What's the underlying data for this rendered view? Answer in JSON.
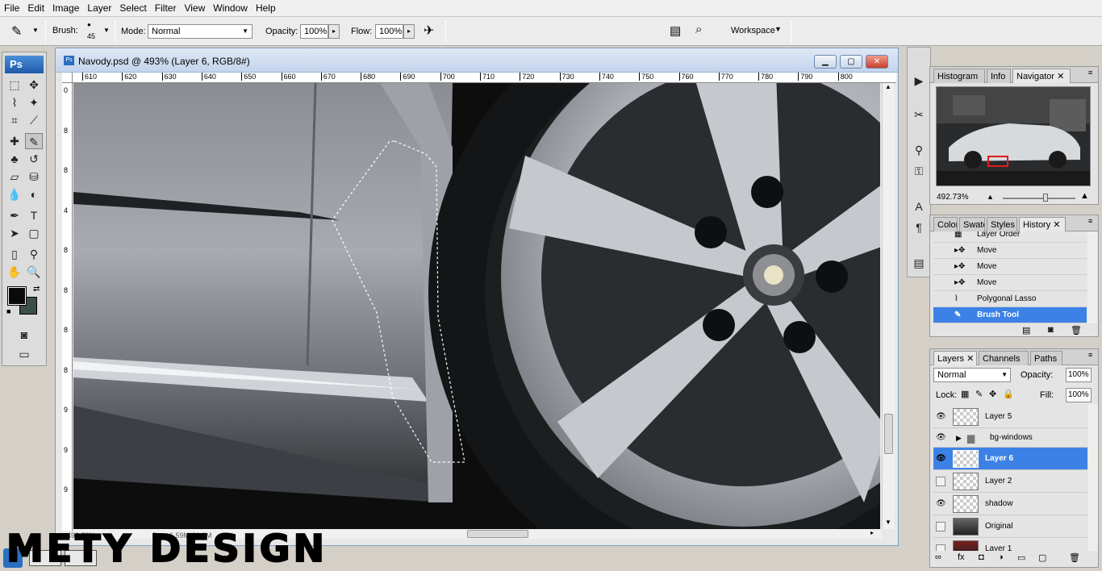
{
  "menu": [
    "File",
    "Edit",
    "Image",
    "Layer",
    "Select",
    "Filter",
    "View",
    "Window",
    "Help"
  ],
  "options": {
    "brush_label": "Brush:",
    "brush_size": "45",
    "mode_label": "Mode:",
    "mode_value": "Normal",
    "opacity_label": "Opacity:",
    "opacity_value": "100%",
    "flow_label": "Flow:",
    "flow_value": "100%",
    "workspace_label": "Workspace"
  },
  "toolbox": {
    "logo": "Ps"
  },
  "document": {
    "title": "Navody.psd @ 493% (Layer 6, RGB/8#)",
    "ruler_h": [
      "610",
      "620",
      "630",
      "640",
      "650",
      "660",
      "670",
      "680",
      "690",
      "700",
      "710",
      "720",
      "730",
      "740",
      "750",
      "760",
      "770",
      "780",
      "790",
      "800"
    ],
    "ruler_v": [
      "0",
      "8",
      "8",
      "4",
      "8",
      "8",
      "8",
      "8",
      "9",
      "9",
      "9"
    ],
    "zoom": "492.73%",
    "doc_size": "Doc: 6.59M/36.9M",
    "colors": {
      "fg": "#0a0a0a",
      "bg": "#3c4e4a"
    }
  },
  "navigator": {
    "tabs": [
      "Histogram",
      "Info",
      "Navigator"
    ],
    "zoom": "492.73%"
  },
  "history": {
    "tabs": [
      "Color",
      "Swatc",
      "Styles",
      "History"
    ],
    "items": [
      "Layer Order",
      "Move",
      "Move",
      "Move",
      "Polygonal Lasso",
      "Brush Tool"
    ],
    "selected": 5
  },
  "layers": {
    "tabs": [
      "Layers",
      "Channels",
      "Paths"
    ],
    "blend_mode": "Normal",
    "opacity_label": "Opacity:",
    "opacity_value": "100%",
    "lock_label": "Lock:",
    "fill_label": "Fill:",
    "fill_value": "100%",
    "items": [
      {
        "name": "Layer 5",
        "visible": true
      },
      {
        "name": "bg-windows",
        "visible": true,
        "group": true
      },
      {
        "name": "Layer 6",
        "visible": true,
        "selected": true
      },
      {
        "name": "Layer 2",
        "visible": false
      },
      {
        "name": "shadow",
        "visible": true
      },
      {
        "name": "Original",
        "visible": false
      },
      {
        "name": "Layer 1",
        "visible": false
      }
    ]
  },
  "watermark": "METY DESIGN"
}
